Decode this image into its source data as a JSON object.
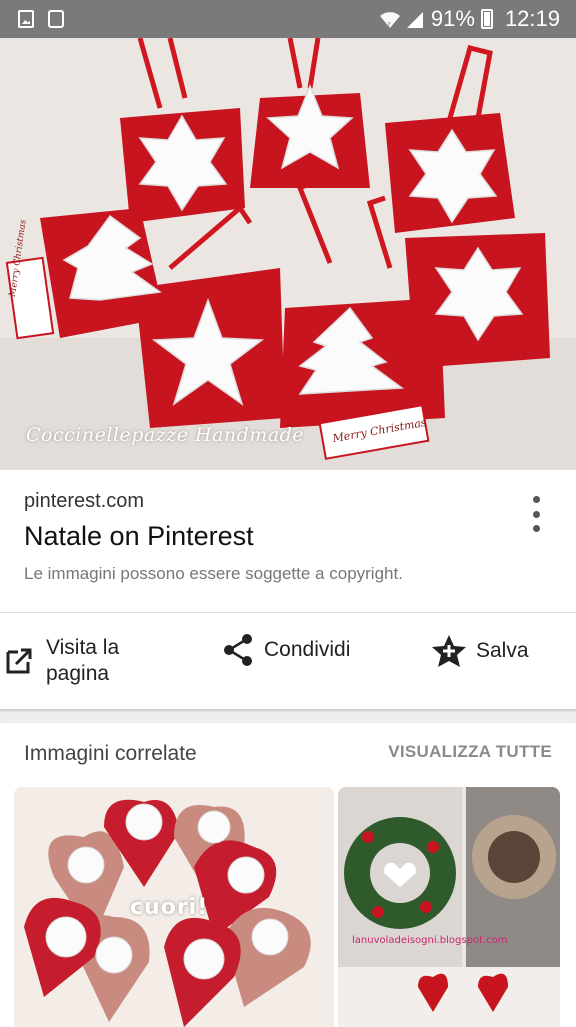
{
  "status_bar": {
    "battery": "91%",
    "time": "12:19"
  },
  "hero": {
    "watermark": "Coccinellepazze Handmade",
    "tag_text_1": "Merry Christmas",
    "tag_text_2": "Merry Christmas"
  },
  "result": {
    "site": "pinterest.com",
    "title": "Natale on Pinterest",
    "copyright_note": "Le immagini possono essere soggette a copyright."
  },
  "actions": {
    "visit_label_line1": "Visita la",
    "visit_label_line2": "pagina",
    "share_label": "Condividi",
    "save_label": "Salva"
  },
  "related": {
    "title": "Immagini correlate",
    "view_all": "VISUALIZZA TUTTE",
    "thumb1_caption": "cuori!",
    "thumb2_caption": "lanuvoladeisogni.blogspot.com"
  },
  "colors": {
    "status_bar_bg": "#7a7a7a",
    "felt_red": "#c8141e",
    "text_primary": "#111111",
    "text_secondary": "#777777"
  },
  "icons": [
    "image-icon",
    "recycle-icon",
    "wifi-icon",
    "signal-icon",
    "battery-icon",
    "more-vert-icon",
    "open-in-new-icon",
    "share-icon",
    "star-icon"
  ]
}
